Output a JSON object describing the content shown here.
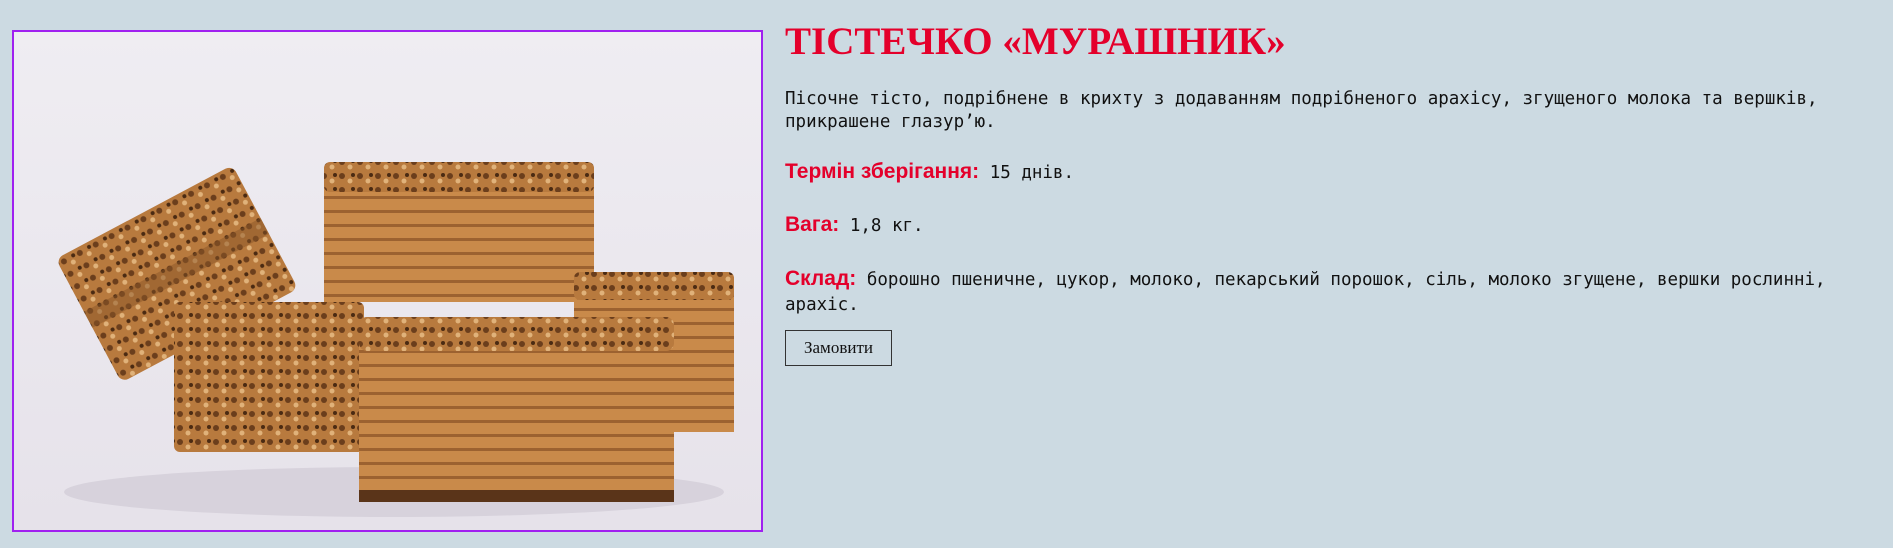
{
  "product": {
    "title": "ТІСТЕЧКО «МУРАШНИК»",
    "description": "Пісочне тісто, подрібнене в крихту з додаванням подрібненого арахісу, згущеного молока та вершків, прикрашене глазур’ю.",
    "storage": {
      "label": "Термін зберігання:",
      "value": "15 днів."
    },
    "weight": {
      "label": "Вага:",
      "value": "1,8 кг."
    },
    "composition": {
      "label": "Склад:",
      "value": "борошно пшеничне, цукор, молоко, пекарський порошок, сіль, молоко згущене, вершки рослинні, арахіс."
    },
    "order_button": "Замовити"
  },
  "image": {
    "icon": "cake-photo",
    "border_color": "#a020f0"
  },
  "colors": {
    "background": "#ccdae2",
    "accent": "#e4002b"
  }
}
